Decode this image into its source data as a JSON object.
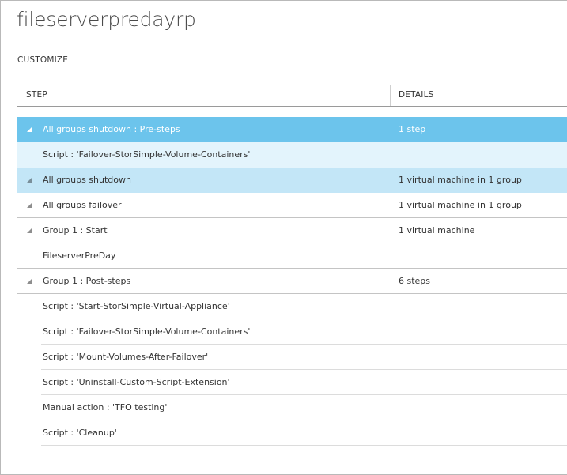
{
  "page": {
    "title": "fileserverpredayrp",
    "section": "CUSTOMIZE"
  },
  "table": {
    "columns": {
      "step": "STEP",
      "details": "DETAILS"
    },
    "rows": [
      {
        "step": "All groups shutdown : Pre-steps",
        "details": "1 step"
      },
      {
        "step": "Script : 'Failover-StorSimple-Volume-Containers'",
        "details": ""
      },
      {
        "step": "All groups shutdown",
        "details": "1 virtual machine in 1 group"
      },
      {
        "step": "All groups failover",
        "details": "1 virtual machine in 1 group"
      },
      {
        "step": "Group 1 : Start",
        "details": "1 virtual machine"
      },
      {
        "step": "FileserverPreDay",
        "details": ""
      },
      {
        "step": "Group 1 : Post-steps",
        "details": "6 steps"
      },
      {
        "step": "Script : 'Start-StorSimple-Virtual-Appliance'",
        "details": ""
      },
      {
        "step": "Script : 'Failover-StorSimple-Volume-Containers'",
        "details": ""
      },
      {
        "step": "Script : 'Mount-Volumes-After-Failover'",
        "details": ""
      },
      {
        "step": "Script : 'Uninstall-Custom-Script-Extension'",
        "details": ""
      },
      {
        "step": "Manual action : 'TFO testing'",
        "details": ""
      },
      {
        "step": "Script : 'Cleanup'",
        "details": ""
      }
    ]
  },
  "colors": {
    "selected_row": "#6cc4ec",
    "light_row": "#e3f4fc",
    "medium_row": "#c3e6f7"
  }
}
